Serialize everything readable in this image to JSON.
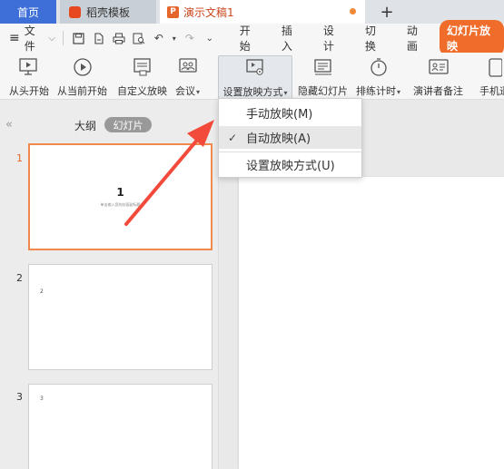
{
  "tabs": {
    "home": "首页",
    "shell": "稻壳模板",
    "doc": "演示文稿1",
    "doc_icon": "P",
    "add": "+"
  },
  "menubar": {
    "file": "文件",
    "items": [
      "开始",
      "插入",
      "设计",
      "切换",
      "动画"
    ],
    "active": "幻灯片放映"
  },
  "ribbon": {
    "from_start": "从头开始",
    "from_current": "从当前开始",
    "custom": "自定义放映",
    "meeting": "会议",
    "setup_show": "设置放映方式",
    "hide_slide": "隐藏幻灯片",
    "rehearse": "排练计时",
    "presenter_notes": "演讲者备注",
    "phone": "手机遥"
  },
  "panel": {
    "collapse": "«",
    "outline": "大纲",
    "slides": "幻灯片"
  },
  "slides": [
    {
      "num": "1",
      "title": "1",
      "subtitle": "单击输入您的封面副标题"
    },
    {
      "num": "2",
      "tiny": "2"
    },
    {
      "num": "3",
      "tiny": "3"
    }
  ],
  "dropdown": {
    "items": [
      {
        "label": "手动放映(M)",
        "checked": false
      },
      {
        "label": "自动放映(A)",
        "checked": true
      },
      {
        "label": "设置放映方式(U)",
        "checked": false
      }
    ],
    "check": "✓"
  },
  "colors": {
    "accent": "#f06c2b",
    "home_tab": "#3e6fd8",
    "arrow": "#f24a3b"
  }
}
